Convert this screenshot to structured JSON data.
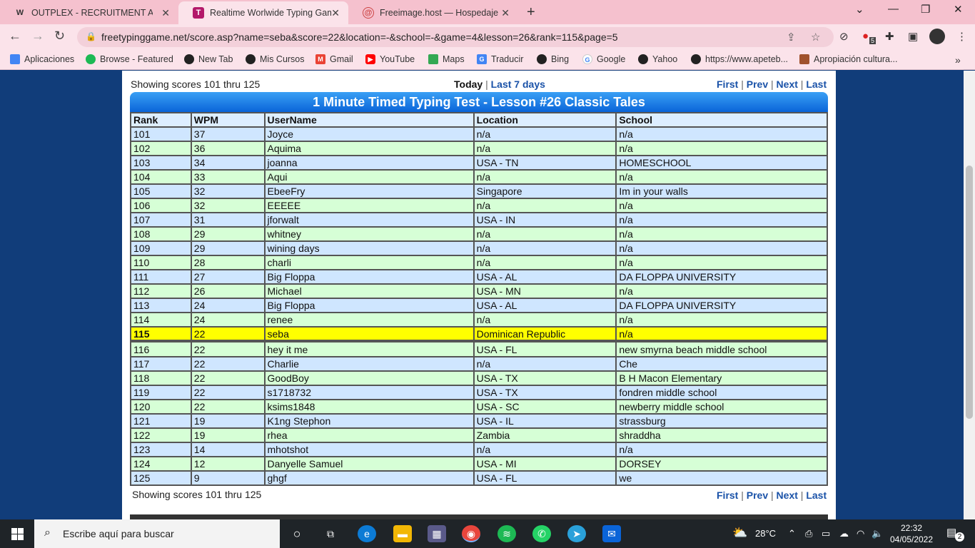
{
  "browser": {
    "tabs": [
      {
        "label": "OUTPLEX - RECRUITMENT ASSES",
        "favicon": "W"
      },
      {
        "label": "Realtime Worlwide Typing Game",
        "favicon": "T"
      },
      {
        "label": "Freeimage.host — Hospedaje de",
        "favicon": "@"
      }
    ],
    "url": "freetypinggame.net/score.asp?name=seba&score=22&location=-&school=-&game=4&lesson=26&rank=115&page=5",
    "bookmarks": [
      "Aplicaciones",
      "Browse - Featured",
      "New Tab",
      "Mis Cursos",
      "Gmail",
      "YouTube",
      "Maps",
      "Traducir",
      "Bing",
      "Google",
      "Yahoo",
      "https://www.apeteb...",
      "Apropiación cultura..."
    ],
    "extension_badge": "5"
  },
  "page": {
    "showing_top": "Showing scores 101 thru 125",
    "showing_bottom": "Showing scores 101 thru 125",
    "period_today": "Today",
    "period_week": "Last 7 days",
    "pager": {
      "first": "First",
      "prev": "Prev",
      "next": "Next",
      "last": "Last",
      "sep": "|"
    },
    "title": "1 Minute Timed Typing Test - Lesson #26 Classic Tales",
    "columns": [
      "Rank",
      "WPM",
      "UserName",
      "Location",
      "School"
    ],
    "rows": [
      [
        "101",
        "37",
        "Joyce",
        "n/a",
        "n/a"
      ],
      [
        "102",
        "36",
        "Aquima",
        "n/a",
        "n/a"
      ],
      [
        "103",
        "34",
        "joanna",
        "USA - TN",
        "HOMESCHOOL"
      ],
      [
        "104",
        "33",
        "Aqui",
        "n/a",
        "n/a"
      ],
      [
        "105",
        "32",
        "EbeeFry",
        "Singapore",
        "Im in your walls"
      ],
      [
        "106",
        "32",
        "EEEEE",
        "n/a",
        "n/a"
      ],
      [
        "107",
        "31",
        "jforwalt",
        "USA - IN",
        "n/a"
      ],
      [
        "108",
        "29",
        "whitney",
        "n/a",
        "n/a"
      ],
      [
        "109",
        "29",
        "wining days",
        "n/a",
        "n/a"
      ],
      [
        "110",
        "28",
        "charli",
        "n/a",
        "n/a"
      ],
      [
        "111",
        "27",
        "Big Floppa",
        "USA - AL",
        "DA FLOPPA UNIVERSITY"
      ],
      [
        "112",
        "26",
        "Michael",
        "USA - MN",
        "n/a"
      ],
      [
        "113",
        "24",
        "Big Floppa",
        "USA - AL",
        "DA FLOPPA UNIVERSITY"
      ],
      [
        "114",
        "24",
        "renee",
        "n/a",
        "n/a"
      ],
      [
        "115",
        "22",
        "seba",
        "Dominican Republic",
        "n/a"
      ],
      [
        "116",
        "22",
        "hey it me",
        "USA - FL",
        "new smyrna beach middle school"
      ],
      [
        "117",
        "22",
        "Charlie",
        "n/a",
        "Che"
      ],
      [
        "118",
        "22",
        "GoodBoy",
        "USA - TX",
        "B H Macon Elementary"
      ],
      [
        "119",
        "22",
        "s1718732",
        "USA - TX",
        "fondren middle school"
      ],
      [
        "120",
        "22",
        "ksims1848",
        "USA - SC",
        "newberry middle school"
      ],
      [
        "121",
        "19",
        "K1ng Stephon",
        "USA - IL",
        "strassburg"
      ],
      [
        "122",
        "19",
        "rhea",
        "Zambia",
        "shraddha"
      ],
      [
        "123",
        "14",
        "mhotshot",
        "n/a",
        "n/a"
      ],
      [
        "124",
        "12",
        "Danyelle Samuel",
        "USA - MI",
        "DORSEY"
      ],
      [
        "125",
        "9",
        "ghgf",
        "USA - FL",
        "we"
      ]
    ],
    "highlight_rank": "115"
  },
  "taskbar": {
    "search_placeholder": "Escribe aquí para buscar",
    "weather": "28°C",
    "time": "22:32",
    "date": "04/05/2022",
    "notifications": "2"
  },
  "colors": {
    "row_blue": "#cfe6ff",
    "row_green": "#d6ffd6",
    "highlight": "#ffff00",
    "banner": "#0a64d8"
  }
}
